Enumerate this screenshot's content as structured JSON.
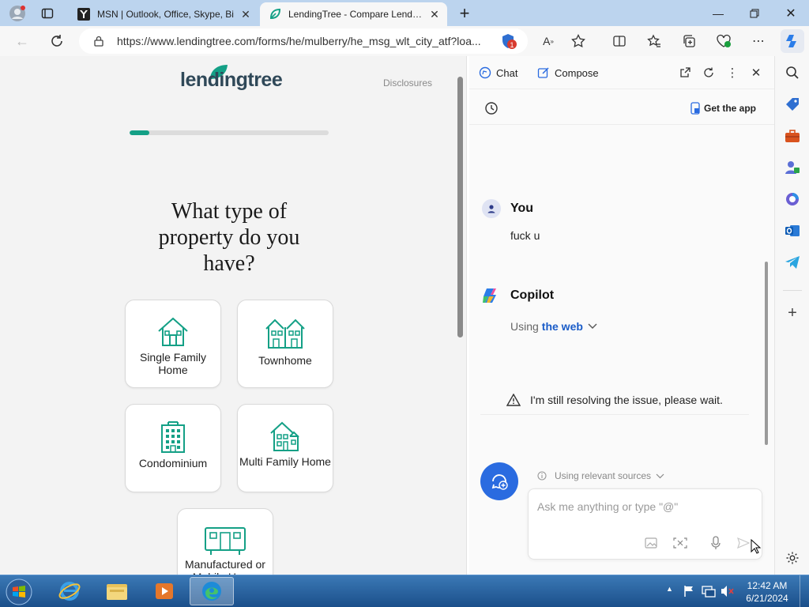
{
  "browser": {
    "tabs": [
      {
        "title": "MSN | Outlook, Office, Skype, Bi",
        "active": false
      },
      {
        "title": "LendingTree - Compare Lenders",
        "active": true
      }
    ],
    "url": "https://www.lendingtree.com/forms/he/mulberry/he_msg_wlt_city_atf?loa...",
    "tracking_badge": "1"
  },
  "page": {
    "logo": "lendingtree",
    "disclosures": "Disclosures",
    "progress_fraction": 0.1,
    "question": "What type of property do you have?",
    "options": [
      {
        "label": "Single Family Home",
        "icon": "house-icon"
      },
      {
        "label": "Townhome",
        "icon": "townhome-icon"
      },
      {
        "label": "Condominium",
        "icon": "condominium-icon"
      },
      {
        "label": "Multi Family Home",
        "icon": "multi-family-icon"
      },
      {
        "label": "Manufactured or Mobile Home",
        "icon": "mobile-home-icon"
      }
    ]
  },
  "copilot": {
    "tabs": [
      "Chat",
      "Compose"
    ],
    "get_app": "Get the app",
    "user_name": "You",
    "user_message": "fuck u",
    "bot_name": "Copilot",
    "using_prefix": "Using",
    "using_link": "the web",
    "warning": "I'm still resolving the issue, please wait.",
    "sources": "Using relevant sources",
    "input_placeholder": "Ask me anything or type \"@\""
  },
  "taskbar": {
    "time": "12:42 AM",
    "date": "6/21/2024"
  },
  "colors": {
    "accent_green": "#14a086",
    "copilot_blue": "#2a6be0",
    "tab_strip": "#bcd4ee"
  }
}
